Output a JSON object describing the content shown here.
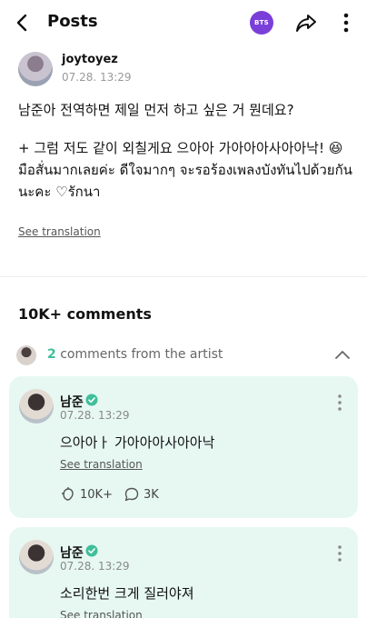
{
  "header": {
    "title": "Posts",
    "badge_label": "BTS",
    "icons": [
      "back-arrow-icon",
      "share-icon",
      "more-vertical-icon"
    ]
  },
  "post": {
    "author": "joytoyez",
    "time": "07.28. 13:29",
    "line1": "남준아 전역하면 제일 먼저 하고 싶은 거 뭔데요?",
    "line2": "+ 그럼 저도 같이 외칠게요 으아아 가아아아사아아낙! 😆",
    "line3": "มือสั่นมากเลยค่ะ ดีใจมากๆ จะรอร้องเพลงบังทันไปด้วยกันนะคะ ♡รักนา",
    "see_translation": "See translation"
  },
  "comments": {
    "title": "10K+ comments",
    "artist_count": "2",
    "artist_label": "comments from the artist",
    "items": [
      {
        "name": "남준",
        "time": "07.28. 13:29",
        "text": "으아아ㅏ 가아아아사아아낙",
        "see_translation": "See translation",
        "likes": "10K+",
        "replies": "3K"
      },
      {
        "name": "남준",
        "time": "07.28. 13:29",
        "text": "소리한번 크게 질러야져",
        "see_translation": "See translation"
      }
    ]
  },
  "colors": {
    "accent": "#3fbf9a",
    "badge": "#7b3fd9",
    "card_bg": "#e7f8f3"
  }
}
